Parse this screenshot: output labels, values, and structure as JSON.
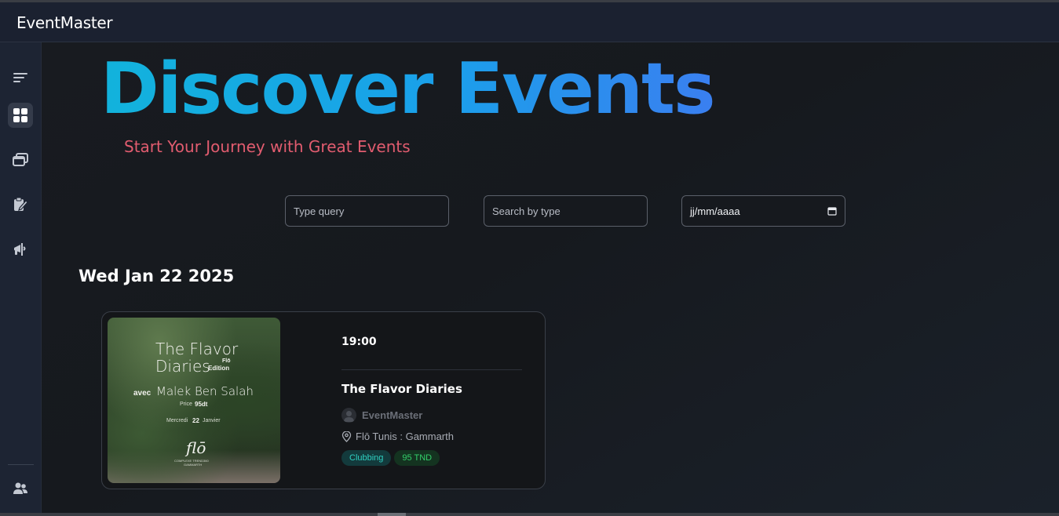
{
  "app": {
    "brand": "EventMaster"
  },
  "sidebar": {
    "items": [
      {
        "name": "menu",
        "icon": "menu-lines-icon",
        "active": false
      },
      {
        "name": "dashboard",
        "icon": "grid-icon",
        "active": true
      },
      {
        "name": "events",
        "icon": "stacked-windows-icon",
        "active": false
      },
      {
        "name": "bookings",
        "icon": "clipboard-edit-icon",
        "active": false
      },
      {
        "name": "announcements",
        "icon": "megaphone-icon",
        "active": false
      }
    ],
    "bottom_item": {
      "name": "users",
      "icon": "users-icon"
    }
  },
  "hero": {
    "title": "Discover Events",
    "subtitle": "Start Your Journey with Great Events"
  },
  "filters": {
    "query_placeholder": "Type query",
    "type_placeholder": "Search by type",
    "date_value": "jj/mm/aaaa"
  },
  "events_group": {
    "date_heading": "Wed Jan 22 2025",
    "events": [
      {
        "time": "19:00",
        "title": "The Flavor Diaries",
        "organizer": "EventMaster",
        "location": "Flō Tunis : Gammarth",
        "type_badge": "Clubbing",
        "price_badge": "95 TND",
        "poster": {
          "line1": "The Flavor",
          "line2": "Diaries",
          "edition_top": "Flō",
          "edition_bottom": "Edition",
          "avec": "avec",
          "artist": "Malek Ben Salah",
          "price_label": "Price",
          "price_value": "95dt",
          "date_pre": "Mercredi",
          "date_num": "22",
          "date_post": "Janvier",
          "logo": "flō",
          "venue_line1": "COMPLEXE TREND360",
          "venue_line2": "GAMMARTH"
        }
      }
    ]
  },
  "colors": {
    "title_gradient_start": "#12b3dc",
    "title_gradient_end": "#3a7ff0",
    "subtitle": "#e15c6f",
    "badge_type": "#2fd0c2",
    "badge_price": "#33d06a"
  }
}
